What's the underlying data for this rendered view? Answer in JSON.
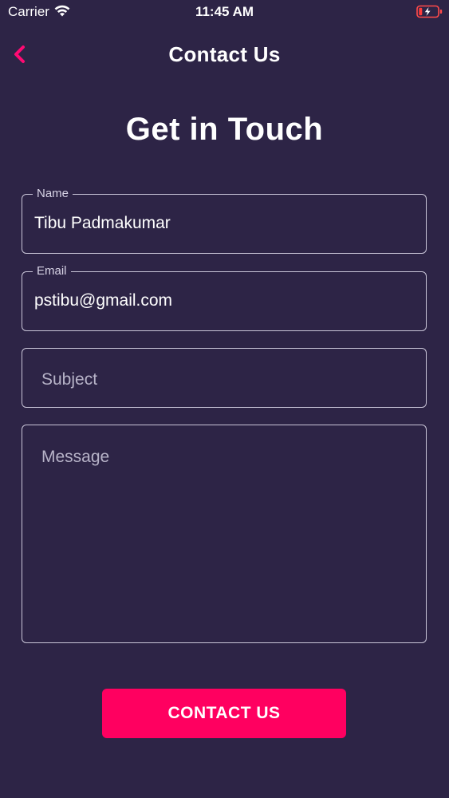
{
  "status_bar": {
    "carrier": "Carrier",
    "time": "11:45 AM",
    "wifi_icon": "wifi-icon",
    "battery_icon": "battery-charging-low-icon"
  },
  "nav": {
    "back_icon": "chevron-left-icon",
    "title": "Contact Us"
  },
  "headline": "Get in Touch",
  "form": {
    "name": {
      "label": "Name",
      "value": "Tibu Padmakumar"
    },
    "email": {
      "label": "Email",
      "value": "pstibu@gmail.com"
    },
    "subject": {
      "placeholder": "Subject"
    },
    "message": {
      "placeholder": "Message"
    }
  },
  "submit_label": "CONTACT US",
  "colors": {
    "background": "#2d2446",
    "accent": "#ff0060",
    "field_border": "#c9c5d8",
    "text": "#ffffff"
  }
}
